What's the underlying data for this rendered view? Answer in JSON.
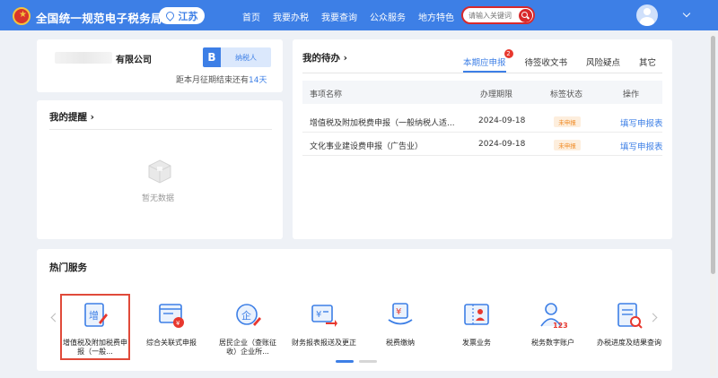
{
  "header": {
    "site_title": "全国统一规范电子税务局",
    "region": "江苏",
    "nav": [
      "首页",
      "我要办税",
      "我要查询",
      "公众服务",
      "地方特色"
    ],
    "search_placeholder": "请输入关键词"
  },
  "company": {
    "name": "有限公司",
    "badge_letter": "B",
    "taxpayer_type": "纳税人",
    "deadline_prefix": "距本月征期结束还有",
    "deadline_days": "14天"
  },
  "reminders": {
    "title": "我的提醒 ›",
    "empty_text": "暂无数据"
  },
  "todo": {
    "title": "我的待办 ›",
    "tabs": [
      {
        "label": "本期应申报",
        "badge": "2"
      },
      {
        "label": "待签收文书"
      },
      {
        "label": "风险疑点"
      },
      {
        "label": "其它"
      }
    ],
    "columns": [
      "事项名称",
      "办理期限",
      "标签状态",
      "操作"
    ],
    "rows": [
      {
        "name": "增值税及附加税费申报（一般纳税人适...",
        "deadline": "2024-09-18",
        "status": "未申报",
        "action": "填写申报表"
      },
      {
        "name": "文化事业建设费申报（广告业）",
        "deadline": "2024-09-18",
        "status": "未申报",
        "action": "填写申报表"
      }
    ]
  },
  "hot_services": {
    "title": "热门服务",
    "items": [
      {
        "label": "增值税及附加税费申报（一般...",
        "icon": "vat-report-icon"
      },
      {
        "label": "综合关联式申报",
        "icon": "combined-report-icon"
      },
      {
        "label": "居民企业（查账征收）企业所...",
        "icon": "enterprise-tax-icon"
      },
      {
        "label": "财务报表报送及更正",
        "icon": "financial-report-icon"
      },
      {
        "label": "税费缴纳",
        "icon": "tax-payment-icon"
      },
      {
        "label": "发票业务",
        "icon": "invoice-icon"
      },
      {
        "label": "税务数字账户",
        "icon": "digital-account-icon"
      },
      {
        "label": "办税进度及结果查询",
        "icon": "progress-query-icon"
      }
    ]
  },
  "colors": {
    "primary": "#3d7fe6",
    "danger": "#d8292b",
    "warning": "#f08a24"
  }
}
